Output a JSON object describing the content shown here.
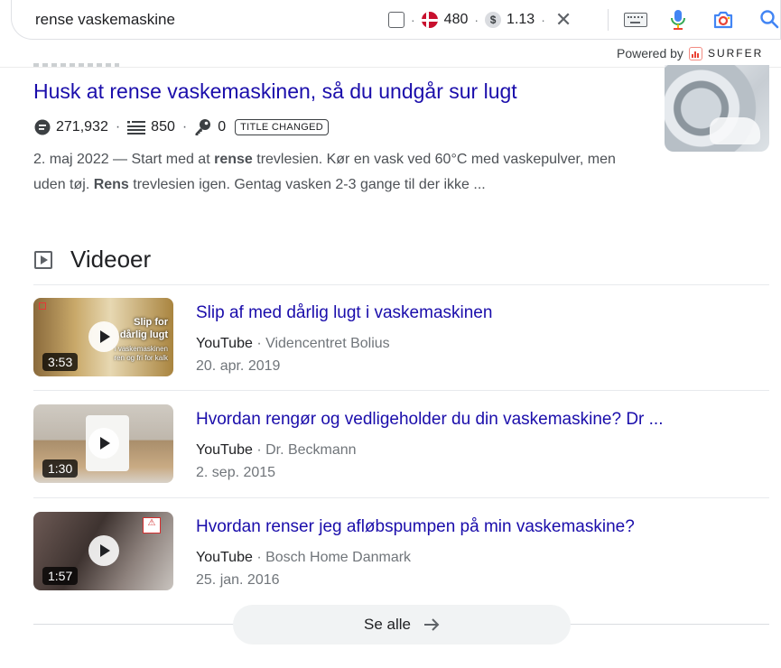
{
  "search": {
    "query": "rense vaskemaskine"
  },
  "toolbar": {
    "volume": "480",
    "cpc": "1.13",
    "dot": "·"
  },
  "powered_by": {
    "label": "Powered by",
    "brand": "SURFER"
  },
  "result": {
    "title": "Husk at rense vaskemaskinen, så du undgår sur lugt",
    "traffic": "271,932",
    "words": "850",
    "keywords": "0",
    "badge": "TITLE CHANGED",
    "snippet_date": "2. maj 2022",
    "snippet_1": " — Start med at ",
    "snippet_b1": "rense",
    "snippet_2": " trevlesien. Kør en vask ved 60°C med vaskepulver, men uden tøj. ",
    "snippet_b2": "Rens",
    "snippet_3": " trevlesien igen. Gentag vasken 2-3 gange til der ikke ..."
  },
  "videos": {
    "heading": "Videoer",
    "items": [
      {
        "title": "Slip af med dårlig lugt i vaskemaskinen",
        "platform": "YouTube",
        "channel": "Videncentret Bolius",
        "date": "20. apr. 2019",
        "duration": "3:53",
        "thumb_text_1": "Slip for",
        "thumb_text_2": "dårlig lugt",
        "thumb_text_3": "i vaskemaskinen",
        "thumb_text_4": "ren og fri for kalk"
      },
      {
        "title": "Hvordan rengør og vedligeholder du din vaskemaskine? Dr ...",
        "platform": "YouTube",
        "channel": "Dr. Beckmann",
        "date": "2. sep. 2015",
        "duration": "1:30"
      },
      {
        "title": "Hvordan renser jeg afløbspumpen på min vaskemaskine?",
        "platform": "YouTube",
        "channel": "Bosch Home Danmark",
        "date": "25. jan. 2016",
        "duration": "1:57"
      }
    ],
    "see_all": "Se alle",
    "separator": " · "
  },
  "colors": {
    "link": "#1a0dab",
    "muted": "#70757a",
    "brand_red": "#ea4335"
  }
}
